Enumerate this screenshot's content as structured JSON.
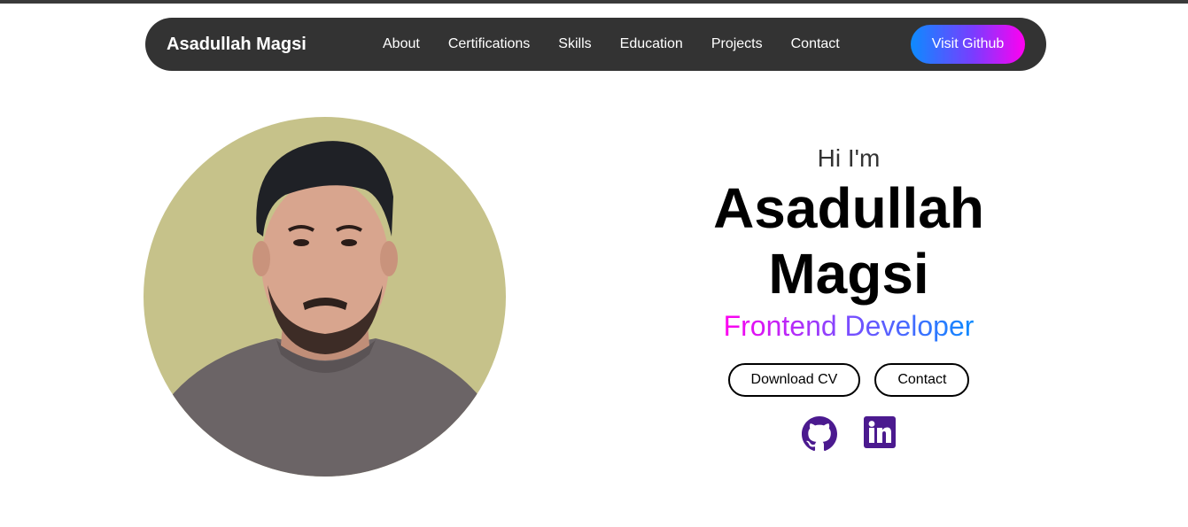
{
  "navbar": {
    "brand": "Asadullah Magsi",
    "links": [
      "About",
      "Certifications",
      "Skills",
      "Education",
      "Projects",
      "Contact"
    ],
    "cta_label": "Visit Github"
  },
  "hero": {
    "greeting": "Hi I'm",
    "name_line1": "Asadullah",
    "name_line2": "Magsi",
    "role": "Frontend Developer",
    "buttons": {
      "download": "Download CV",
      "contact": "Contact"
    },
    "social_icons": [
      "github-icon",
      "linkedin-icon"
    ]
  },
  "colors": {
    "nav_bg": "#333333",
    "avatar_bg": "#c6c28a",
    "social_icon": "#4b1a8f",
    "gradient": [
      "#0d8bff",
      "#7a3cff",
      "#ff00f0"
    ]
  }
}
